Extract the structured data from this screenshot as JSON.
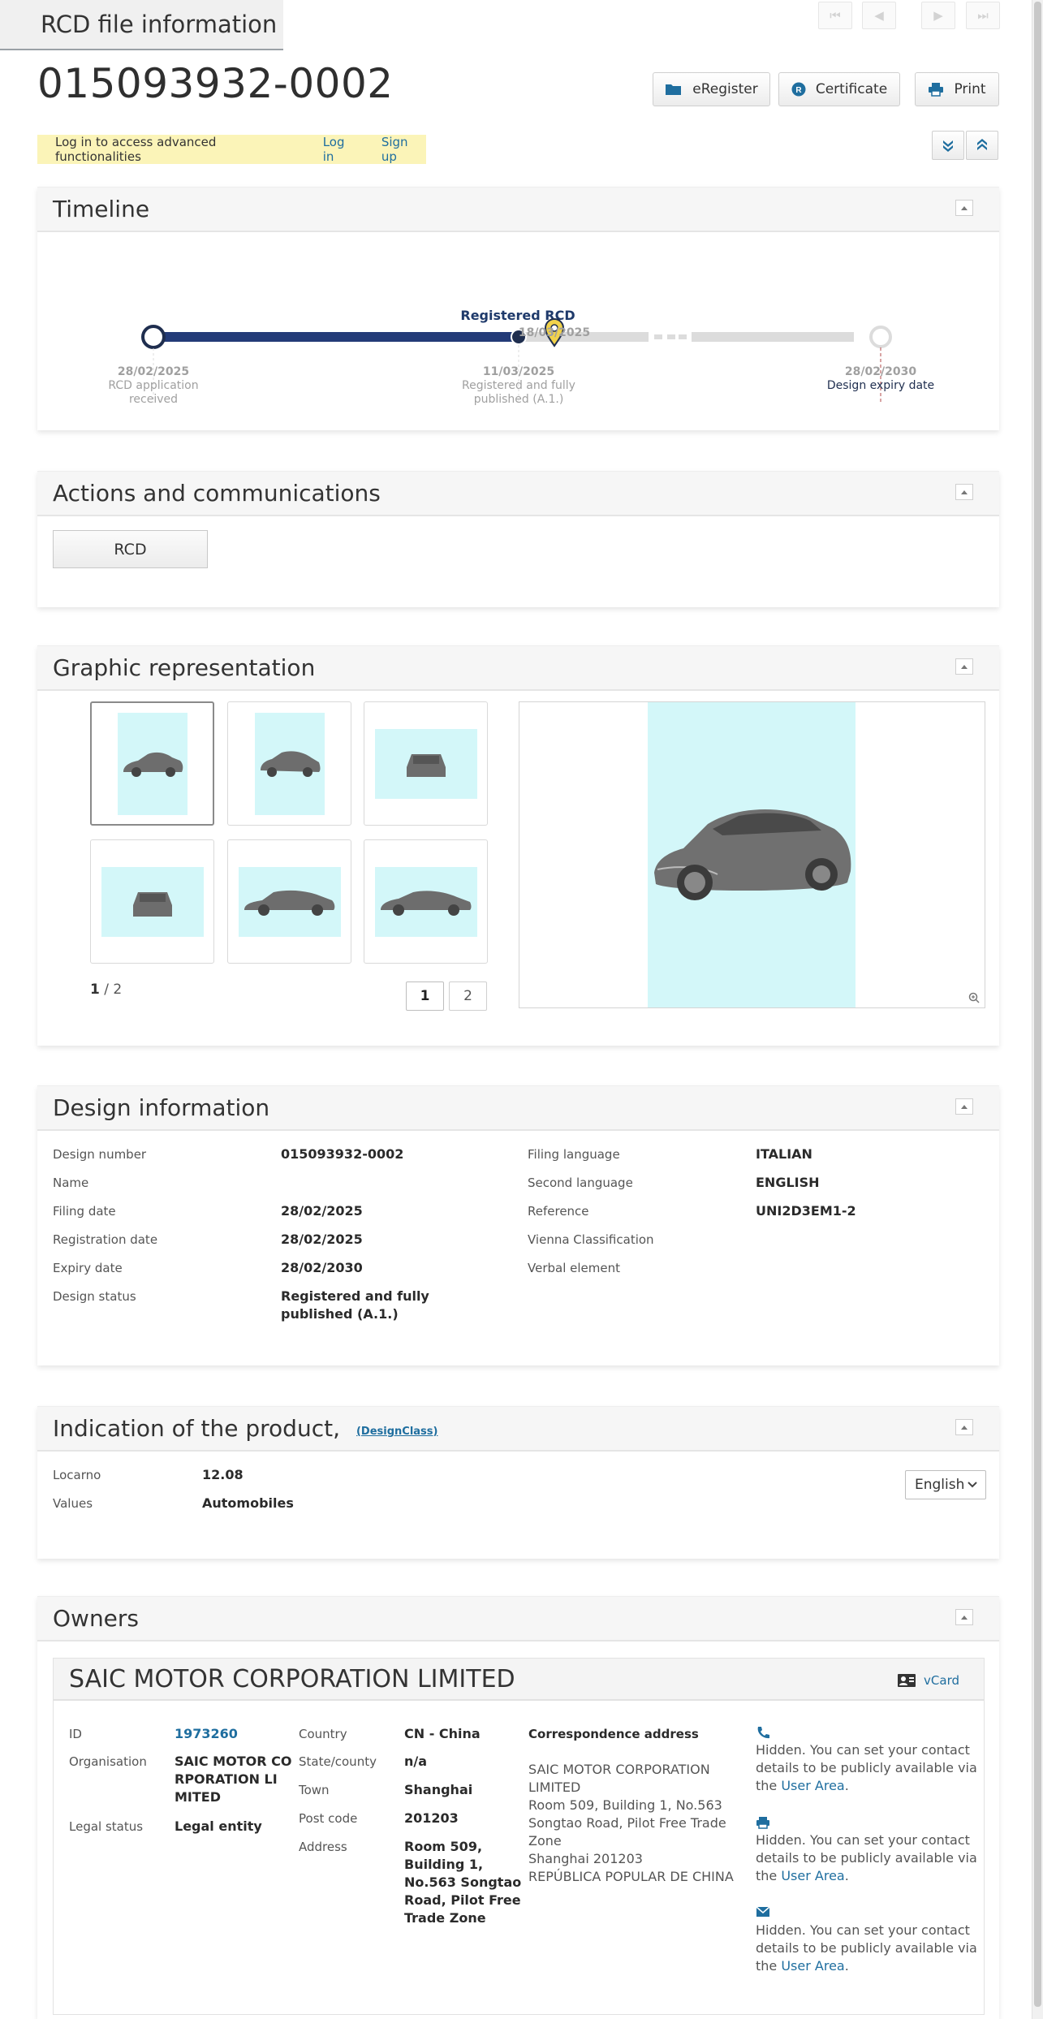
{
  "tab_title": "RCD file information",
  "nav_buttons": [
    "⏮",
    "◀",
    "▶",
    "⏭"
  ],
  "file_number": "015093932-0002",
  "buttons": {
    "eregister": "eRegister",
    "certificate": "Certificate",
    "print": "Print"
  },
  "login_bar": {
    "message": "Log in to access advanced functionalities",
    "login": "Log in",
    "signup": "Sign up"
  },
  "timeline": {
    "title": "Timeline",
    "status_label": "Registered RCD",
    "events": [
      {
        "date": "28/02/2025",
        "label": "RCD application received"
      },
      {
        "date": "11/03/2025",
        "label": "Registered and fully published (A.1.)"
      },
      {
        "date": "18/03/2025",
        "label": ""
      },
      {
        "date": "28/02/2030",
        "label": "Design expiry date"
      }
    ]
  },
  "actions": {
    "title": "Actions and communications",
    "rcd_button": "RCD"
  },
  "graphic": {
    "title": "Graphic representation",
    "page_current": "1",
    "page_total": "/ 2",
    "pages": [
      "1",
      "2"
    ],
    "thumb_bg_color": "#d3f7f9"
  },
  "design_info": {
    "title": "Design information",
    "left": [
      {
        "label": "Design number",
        "value": "015093932-0002"
      },
      {
        "label": "Name",
        "value": ""
      },
      {
        "label": "Filing date",
        "value": "28/02/2025"
      },
      {
        "label": "Registration date",
        "value": "28/02/2025"
      },
      {
        "label": "Expiry date",
        "value": "28/02/2030"
      },
      {
        "label": "Design status",
        "value": "Registered and fully published (A.1.)"
      }
    ],
    "right": [
      {
        "label": "Filing language",
        "value": "ITALIAN"
      },
      {
        "label": "Second language",
        "value": "ENGLISH"
      },
      {
        "label": "Reference",
        "value": "UNI2D3EM1-2"
      },
      {
        "label": "Vienna Classification",
        "value": ""
      },
      {
        "label": "Verbal element",
        "value": ""
      }
    ]
  },
  "product": {
    "title": "Indication of the product,",
    "designclass": "(DesignClass)",
    "rows": [
      {
        "label": "Locarno",
        "value": "12.08"
      },
      {
        "label": "Values",
        "value": "Automobiles"
      }
    ],
    "language": "English"
  },
  "owners": {
    "title": "Owners",
    "name": "SAIC MOTOR CORPORATION LIMITED",
    "vcard": "vCard",
    "id_label": "ID",
    "id": "1973260",
    "org_label": "Organisation",
    "org_lines": [
      "SAIC MOTOR CO",
      "RPORATION LI",
      "MITED"
    ],
    "legal_label": "Legal status",
    "legal": "Legal entity",
    "country_label": "Country",
    "country": "CN - China",
    "state_label": "State/county",
    "state": "n/a",
    "town_label": "Town",
    "town": "Shanghai",
    "postcode_label": "Post code",
    "postcode": "201203",
    "address_label": "Address",
    "address_lines": [
      "Room 509,",
      "Building 1,",
      "No.563 Songtao",
      "Road, Pilot Free",
      "Trade Zone"
    ],
    "corr_title": "Correspondence address",
    "corr_lines": [
      "SAIC MOTOR CORPORATION",
      "LIMITED",
      "Room 509, Building 1, No.563",
      "Songtao Road, Pilot Free Trade",
      "Zone",
      "Shanghai 201203",
      "REPÚBLICA POPULAR DE CHINA"
    ],
    "hidden_lines": [
      "Hidden. You can set your contact",
      "details to be publicly available via",
      "the "
    ],
    "user_area": "User Area",
    "period": "."
  }
}
